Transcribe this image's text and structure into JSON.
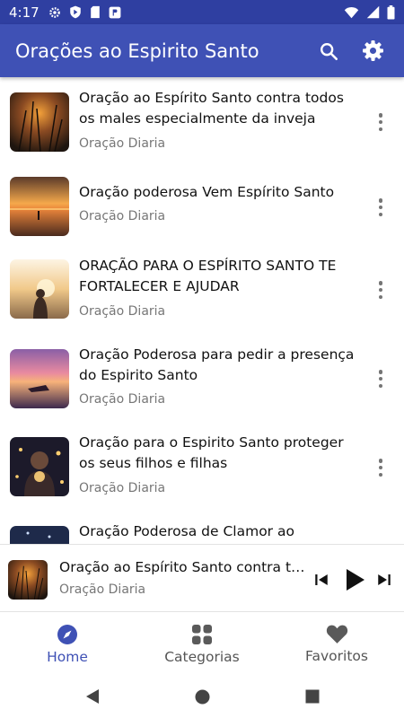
{
  "status_bar": {
    "time": "4:17"
  },
  "app_bar": {
    "title": "Orações ao Espirito Santo"
  },
  "items": [
    {
      "title": "Oração ao Espírito Santo contra todos os males especialmente da inveja",
      "subtitle": "Oração Diaria"
    },
    {
      "title": "Oração poderosa Vem Espírito Santo",
      "subtitle": "Oração Diaria"
    },
    {
      "title": "ORAÇÃO PARA O ESPÍRITO SANTO TE FORTALECER E AJUDAR",
      "subtitle": "Oração Diaria"
    },
    {
      "title": "Oração Poderosa para pedir a presença do Espirito Santo",
      "subtitle": "Oração Diaria"
    },
    {
      "title": "Oração para o Espirito Santo proteger os seus filhos e filhas",
      "subtitle": "Oração Diaria"
    },
    {
      "title": "Oração Poderosa de Clamor ao",
      "subtitle": ""
    }
  ],
  "mini_player": {
    "title": "Oração ao Espírito Santo contra todos os males especialmente da inveja",
    "subtitle": "Oração Diaria"
  },
  "bottom_nav": [
    {
      "label": "Home",
      "icon": "compass-icon",
      "active": true
    },
    {
      "label": "Categorias",
      "icon": "grid-icon",
      "active": false
    },
    {
      "label": "Favoritos",
      "icon": "heart-icon",
      "active": false
    }
  ],
  "colors": {
    "primary": "#3f51b5",
    "status_bar": "#2f3fa1",
    "subtitle": "#777777"
  }
}
